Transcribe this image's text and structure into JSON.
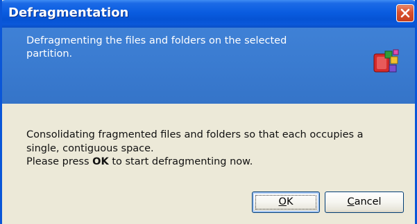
{
  "window": {
    "title": "Defragmentation",
    "close_icon": "close-icon"
  },
  "header": {
    "description": "Defragmenting the files and folders on the selected partition.",
    "icon": "defrag-app-icon"
  },
  "body": {
    "line1": "Consolidating fragmented files and folders so that each occupies a",
    "line2": "single, contiguous space.",
    "line3_prefix": "Please press ",
    "line3_bold": "OK",
    "line3_suffix": " to start defragmenting now."
  },
  "buttons": {
    "ok_accel": "O",
    "ok_rest": "K",
    "cancel_accel": "C",
    "cancel_rest": "ancel"
  },
  "colors": {
    "titlebar": "#0a5ce0",
    "header_panel": "#3a7bd0",
    "dialog_body": "#ece9d8",
    "close_button": "#d9502e"
  }
}
